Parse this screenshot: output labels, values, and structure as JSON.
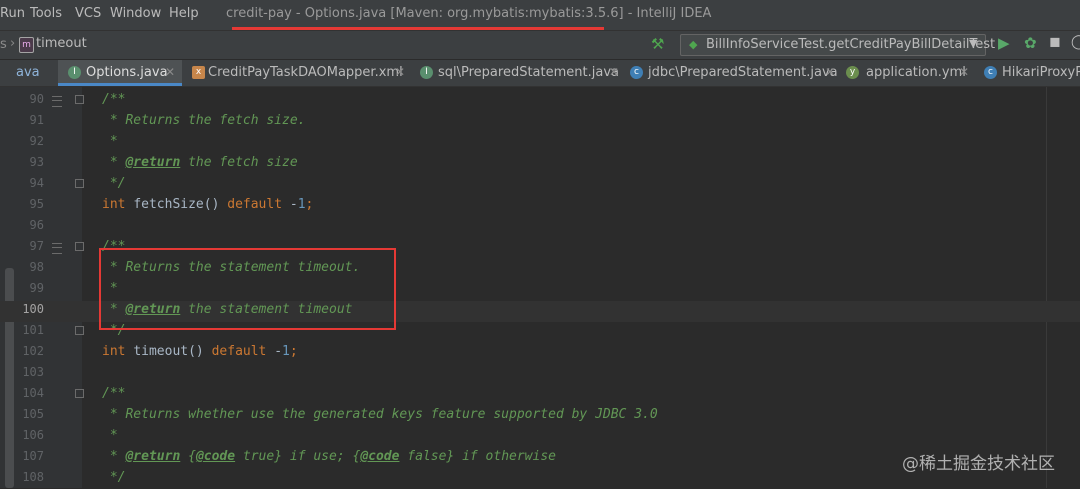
{
  "menubar": {
    "items": [
      "Run",
      "Tools",
      "VCS",
      "Window",
      "Help"
    ],
    "title": "credit-pay - Options.java [Maven: org.mybatis:mybatis:3.5.6] - IntelliJ IDEA"
  },
  "navbar": {
    "left_fragment": "s",
    "breadcrumb_separator": "›",
    "breadcrumb_icon": "m",
    "breadcrumb": "timeout",
    "run_configuration": "BillInfoServiceTest.getCreditPayBillDetailTest",
    "icons": [
      "hammer-icon",
      "run-icon",
      "debug-icon",
      "coverage-icon"
    ]
  },
  "tabs": [
    {
      "label": "ava",
      "active": false,
      "icon": "none"
    },
    {
      "label": "Options.java",
      "active": true,
      "icon": "interface-icon"
    },
    {
      "label": "CreditPayTaskDAOMapper.xml",
      "active": false,
      "icon": "xml-icon"
    },
    {
      "label": "sql\\PreparedStatement.java",
      "active": false,
      "icon": "interface-icon"
    },
    {
      "label": "jdbc\\PreparedStatement.java",
      "active": false,
      "icon": "class-icon"
    },
    {
      "label": "application.yml",
      "active": false,
      "icon": "yml-icon"
    },
    {
      "label": "HikariProxyPr",
      "active": false,
      "icon": "class-icon"
    }
  ],
  "editor": {
    "current_line": "100",
    "lines": [
      {
        "n": "90",
        "text": "/**"
      },
      {
        "n": "91",
        "text": " * Returns the fetch size."
      },
      {
        "n": "92",
        "text": " *"
      },
      {
        "n": "93",
        "text": " * @return the fetch size"
      },
      {
        "n": "94",
        "text": " */"
      },
      {
        "n": "95",
        "text": "int fetchSize() default -1;"
      },
      {
        "n": "96",
        "text": ""
      },
      {
        "n": "97",
        "text": "/**"
      },
      {
        "n": "98",
        "text": " * Returns the statement timeout."
      },
      {
        "n": "99",
        "text": " *"
      },
      {
        "n": "100",
        "text": " * @return the statement timeout"
      },
      {
        "n": "101",
        "text": " */"
      },
      {
        "n": "102",
        "text": "int timeout() default -1;"
      },
      {
        "n": "103",
        "text": ""
      },
      {
        "n": "104",
        "text": "/**"
      },
      {
        "n": "105",
        "text": " * Returns whether use the generated keys feature supported by JDBC 3.0"
      },
      {
        "n": "106",
        "text": " *"
      },
      {
        "n": "107",
        "text": " * @return {@code true} if use; {@code false} if otherwise"
      },
      {
        "n": "108",
        "text": " */"
      }
    ]
  },
  "watermark": "@稀土掘金技术社区",
  "colors": {
    "annotation_red": "#e53935",
    "doc_comment": "#629755",
    "keyword": "#cc7832",
    "method": "#ffc66d",
    "number": "#6897bb"
  }
}
